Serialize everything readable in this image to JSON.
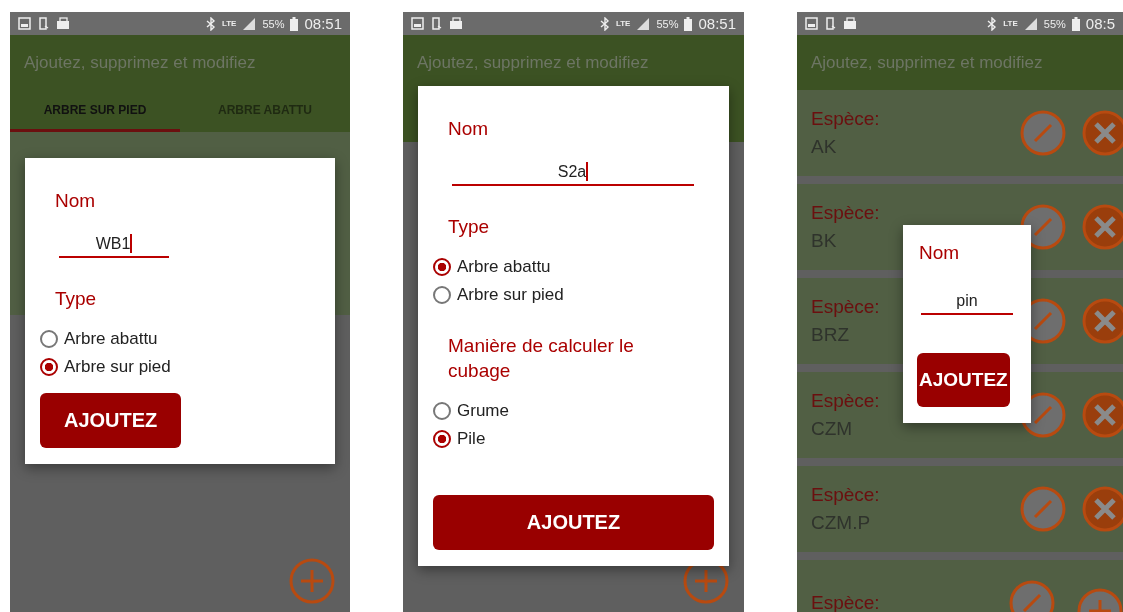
{
  "screens": [
    {
      "status_bar": {
        "network": "LTE",
        "battery": "55%",
        "time": "08:51"
      },
      "app_bar": {
        "title": "Ajoutez, supprimez et modifiez"
      },
      "tabs": [
        {
          "label": "ARBRE SUR PIED",
          "selected": true
        },
        {
          "label": "ARBRE ABATTU",
          "selected": false
        }
      ],
      "dialog": {
        "title": "Nom",
        "name_field": {
          "value": "WB1"
        },
        "sections": [
          {
            "heading": "Type",
            "options": [
              {
                "label": "Arbre abattu",
                "selected": false
              },
              {
                "label": "Arbre sur pied",
                "selected": true
              }
            ]
          }
        ],
        "button": "AJOUTEZ"
      }
    },
    {
      "status_bar": {
        "network": "LTE",
        "battery": "55%",
        "time": "08:51"
      },
      "app_bar": {
        "title": "Ajoutez, supprimez et modifiez"
      },
      "dialog": {
        "title": "Nom",
        "name_field": {
          "value": "S2a"
        },
        "sections": [
          {
            "heading": "Type",
            "options": [
              {
                "label": "Arbre abattu",
                "selected": true
              },
              {
                "label": "Arbre sur pied",
                "selected": false
              }
            ]
          },
          {
            "heading": "Manière de calculer le cubage",
            "options": [
              {
                "label": "Grume",
                "selected": false
              },
              {
                "label": "Pile",
                "selected": true
              }
            ]
          }
        ],
        "button": "AJOUTEZ"
      }
    },
    {
      "status_bar": {
        "network": "LTE",
        "battery": "55%",
        "time": "08:5"
      },
      "app_bar": {
        "title": "Ajoutez, supprimez et modifiez"
      },
      "list": [
        {
          "label": "Espèce:",
          "value": "AK"
        },
        {
          "label": "Espèce:",
          "value": "BK"
        },
        {
          "label": "Espèce:",
          "value": "BRZ"
        },
        {
          "label": "Espèce:",
          "value": "CZM"
        },
        {
          "label": "Espèce:",
          "value": "CZM.P"
        },
        {
          "label": "Espèce:"
        }
      ],
      "dialog": {
        "title": "Nom",
        "name_field": {
          "value": "pin"
        },
        "button": "AJOUTEZ"
      }
    }
  ]
}
